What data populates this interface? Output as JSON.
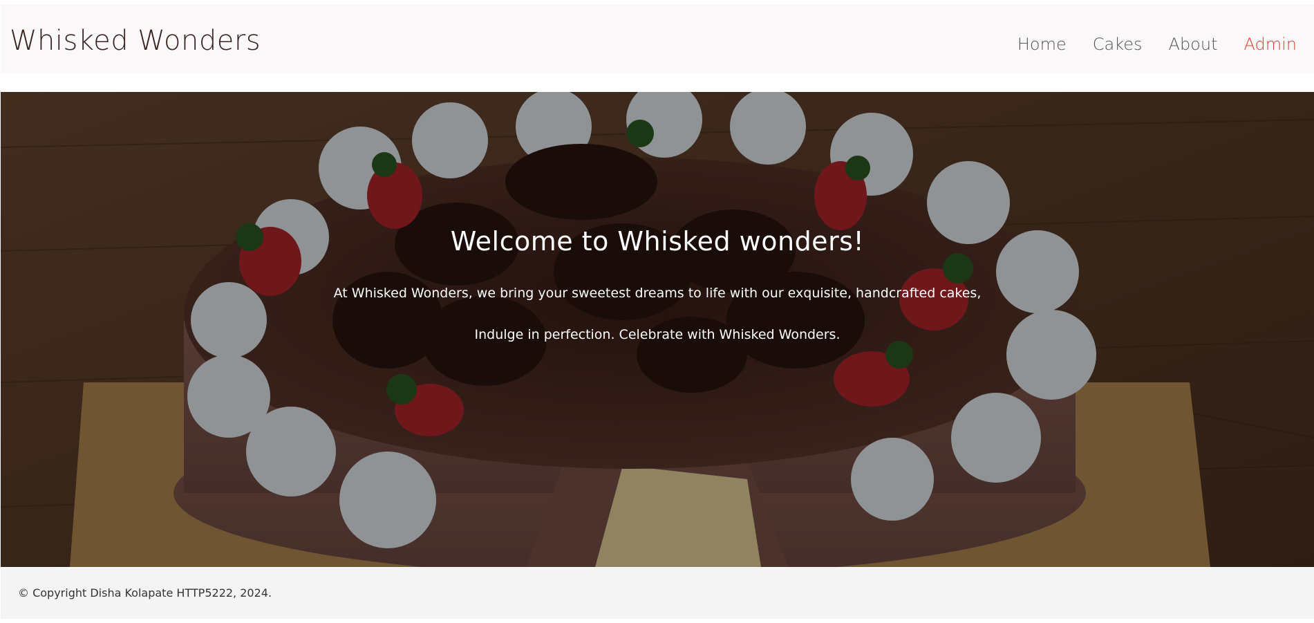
{
  "header": {
    "brand": "Whisked Wonders",
    "nav": [
      {
        "label": "Home"
      },
      {
        "label": "Cakes"
      },
      {
        "label": "About"
      },
      {
        "label": "Admin",
        "active": true
      }
    ]
  },
  "hero": {
    "title": "Welcome to Whisked wonders!",
    "line1": "At Whisked Wonders, we bring your sweetest dreams to life with our exquisite, handcrafted cakes,",
    "line2": "Indulge in perfection. Celebrate with Whisked Wonders.",
    "image": "chocolate-strawberry-cake-photo"
  },
  "footer": {
    "copyright": "© Copyright Disha Kolapate HTTP5222, 2024."
  },
  "colors": {
    "brand_text": "#3a2424",
    "nav_text": "#555555",
    "active_nav": "#e53935",
    "header_bg": "#faf8f8",
    "footer_bg": "#f4f4f4"
  }
}
